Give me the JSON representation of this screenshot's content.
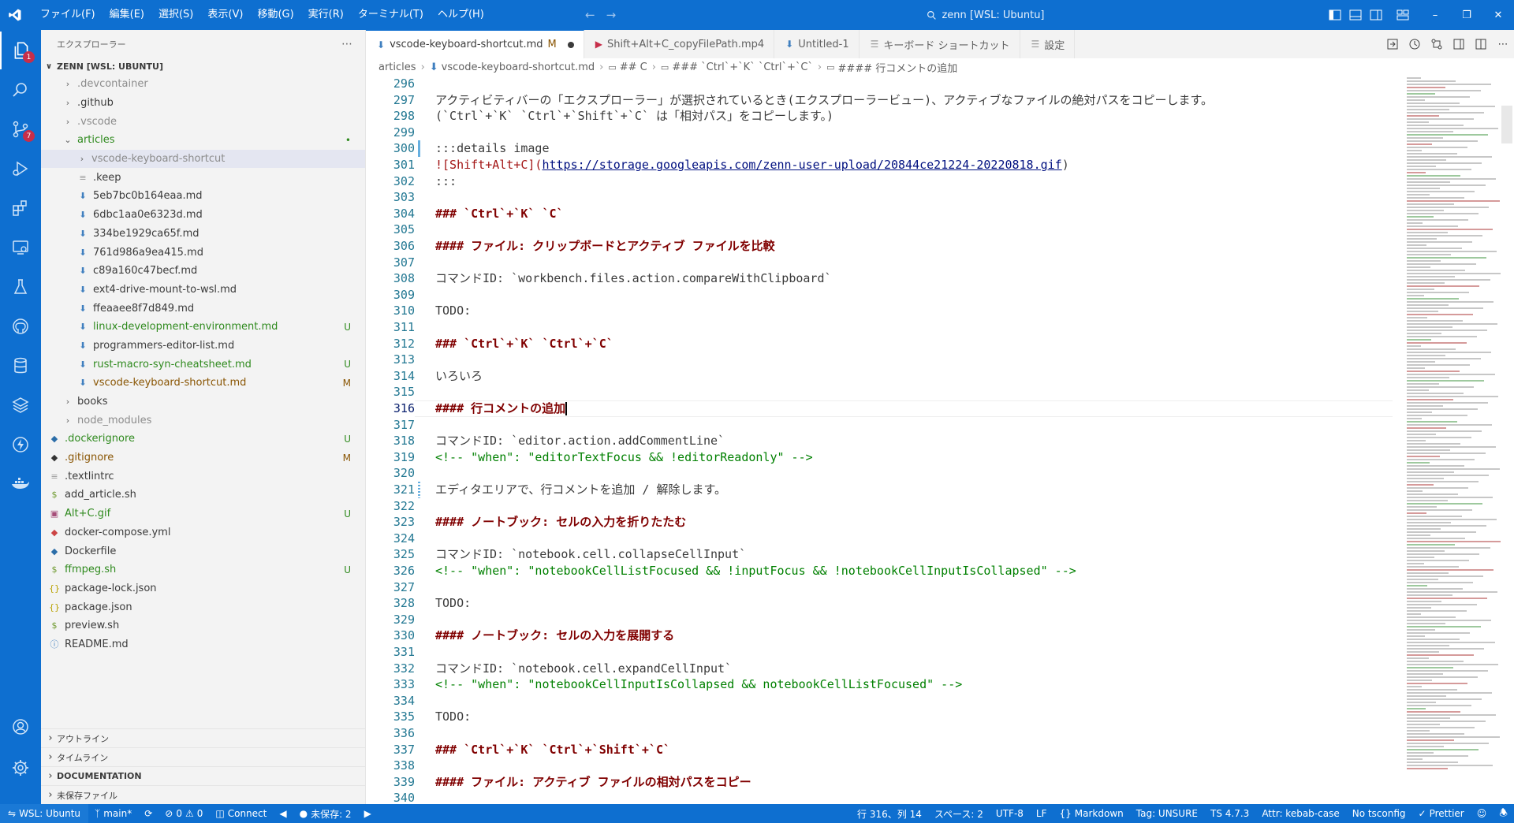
{
  "titlebar": {
    "menu": [
      "ファイル(F)",
      "編集(E)",
      "選択(S)",
      "表示(V)",
      "移動(G)",
      "実行(R)",
      "ターミナル(T)",
      "ヘルプ(H)"
    ],
    "command_center": "zenn [WSL: Ubuntu]"
  },
  "activitybar": {
    "explorer_badge": "1",
    "scm_badge": "7"
  },
  "sidebar": {
    "title": "エクスプローラー",
    "root": "ZENN [WSL: UBUNTU]",
    "tree": [
      {
        "name": ".devcontainer",
        "type": "folder",
        "depth": 1,
        "style": "dim",
        "status": ""
      },
      {
        "name": ".github",
        "type": "folder",
        "depth": 1,
        "style": "",
        "status": ""
      },
      {
        "name": ".vscode",
        "type": "folder",
        "depth": 1,
        "style": "dim",
        "status": ""
      },
      {
        "name": "articles",
        "type": "folder-open",
        "depth": 1,
        "style": "new",
        "status": "•"
      },
      {
        "name": "vscode-keyboard-shortcut",
        "type": "folder",
        "depth": 2,
        "style": "dim",
        "status": ""
      },
      {
        "name": ".keep",
        "type": "file",
        "depth": 2,
        "style": "",
        "status": ""
      },
      {
        "name": "5eb7bc0b164eaa.md",
        "type": "md",
        "depth": 2,
        "style": "",
        "status": ""
      },
      {
        "name": "6dbc1aa0e6323d.md",
        "type": "md",
        "depth": 2,
        "style": "",
        "status": ""
      },
      {
        "name": "334be1929ca65f.md",
        "type": "md",
        "depth": 2,
        "style": "",
        "status": ""
      },
      {
        "name": "761d986a9ea415.md",
        "type": "md",
        "depth": 2,
        "style": "",
        "status": ""
      },
      {
        "name": "c89a160c47becf.md",
        "type": "md",
        "depth": 2,
        "style": "",
        "status": ""
      },
      {
        "name": "ext4-drive-mount-to-wsl.md",
        "type": "md",
        "depth": 2,
        "style": "",
        "status": ""
      },
      {
        "name": "ffeaaee8f7d849.md",
        "type": "md",
        "depth": 2,
        "style": "",
        "status": ""
      },
      {
        "name": "linux-development-environment.md",
        "type": "md",
        "depth": 2,
        "style": "new",
        "status": "U"
      },
      {
        "name": "programmers-editor-list.md",
        "type": "md",
        "depth": 2,
        "style": "",
        "status": ""
      },
      {
        "name": "rust-macro-syn-cheatsheet.md",
        "type": "md",
        "depth": 2,
        "style": "new",
        "status": "U"
      },
      {
        "name": "vscode-keyboard-shortcut.md",
        "type": "md",
        "depth": 2,
        "style": "mod",
        "status": "M"
      },
      {
        "name": "books",
        "type": "folder",
        "depth": 1,
        "style": "",
        "status": ""
      },
      {
        "name": "node_modules",
        "type": "folder",
        "depth": 1,
        "style": "dim",
        "status": ""
      },
      {
        "name": ".dockerignore",
        "type": "docker",
        "depth": 0,
        "style": "new",
        "status": "U"
      },
      {
        "name": ".gitignore",
        "type": "git",
        "depth": 0,
        "style": "mod",
        "status": "M"
      },
      {
        "name": ".textlintrc",
        "type": "file",
        "depth": 0,
        "style": "",
        "status": ""
      },
      {
        "name": "add_article.sh",
        "type": "sh",
        "depth": 0,
        "style": "",
        "status": ""
      },
      {
        "name": "Alt+C.gif",
        "type": "img",
        "depth": 0,
        "style": "new",
        "status": "U"
      },
      {
        "name": "docker-compose.yml",
        "type": "yml",
        "depth": 0,
        "style": "",
        "status": ""
      },
      {
        "name": "Dockerfile",
        "type": "docker",
        "depth": 0,
        "style": "",
        "status": ""
      },
      {
        "name": "ffmpeg.sh",
        "type": "sh",
        "depth": 0,
        "style": "new",
        "status": "U"
      },
      {
        "name": "package-lock.json",
        "type": "json",
        "depth": 0,
        "style": "",
        "status": ""
      },
      {
        "name": "package.json",
        "type": "json",
        "depth": 0,
        "style": "",
        "status": ""
      },
      {
        "name": "preview.sh",
        "type": "sh",
        "depth": 0,
        "style": "",
        "status": ""
      },
      {
        "name": "README.md",
        "type": "info",
        "depth": 0,
        "style": "",
        "status": ""
      }
    ],
    "sections": [
      {
        "label": "アウトライン",
        "bold": false
      },
      {
        "label": "タイムライン",
        "bold": false
      },
      {
        "label": "DOCUMENTATION",
        "bold": true
      },
      {
        "label": "未保存ファイル",
        "bold": false
      }
    ]
  },
  "tabs": [
    {
      "label": "vscode-keyboard-shortcut.md",
      "suffix": "M",
      "active": true,
      "icon": "md",
      "dirty": true
    },
    {
      "label": "Shift+Alt+C_copyFilePath.mp4",
      "suffix": "",
      "active": false,
      "icon": "media",
      "dirty": false
    },
    {
      "label": "Untitled-1",
      "suffix": "",
      "active": false,
      "icon": "md",
      "dirty": false
    },
    {
      "label": "キーボード ショートカット",
      "suffix": "",
      "active": false,
      "icon": "list",
      "dirty": false
    },
    {
      "label": "設定",
      "suffix": "",
      "active": false,
      "icon": "list",
      "dirty": false
    }
  ],
  "breadcrumbs": [
    "articles",
    "vscode-keyboard-shortcut.md",
    "## C",
    "### `Ctrl`+`K` `Ctrl`+`C`",
    "#### 行コメントの追加"
  ],
  "editor": {
    "cursor_line": 316,
    "lines": [
      {
        "n": "296",
        "t": "",
        "k": ""
      },
      {
        "n": "297",
        "t": "アクティビティバーの「エクスプローラー」が選択されているとき(エクスプローラービュー)、アクティブなファイルの絶対パスをコピーします。",
        "k": ""
      },
      {
        "n": "298",
        "t": "(`Ctrl`+`K` `Ctrl`+`Shift`+`C` は「相対パス」をコピーします。)",
        "k": ""
      },
      {
        "n": "299",
        "t": "",
        "k": ""
      },
      {
        "n": "300",
        "t": ":::details image",
        "k": ""
      },
      {
        "n": "301",
        "t": "![Shift+Alt+C](https://storage.googleapis.com/zenn-user-upload/20844ce21224-20220818.gif)",
        "k": "link"
      },
      {
        "n": "302",
        "t": ":::",
        "k": ""
      },
      {
        "n": "303",
        "t": "",
        "k": ""
      },
      {
        "n": "304",
        "t": "### `Ctrl`+`K` `C`",
        "k": "hd"
      },
      {
        "n": "305",
        "t": "",
        "k": ""
      },
      {
        "n": "306",
        "t": "#### ファイル: クリップボードとアクティブ ファイルを比較",
        "k": "hd"
      },
      {
        "n": "307",
        "t": "",
        "k": ""
      },
      {
        "n": "308",
        "t": "コマンドID: `workbench.files.action.compareWithClipboard`",
        "k": ""
      },
      {
        "n": "309",
        "t": "",
        "k": ""
      },
      {
        "n": "310",
        "t": "TODO:",
        "k": ""
      },
      {
        "n": "311",
        "t": "",
        "k": ""
      },
      {
        "n": "312",
        "t": "### `Ctrl`+`K` `Ctrl`+`C`",
        "k": "hd"
      },
      {
        "n": "313",
        "t": "",
        "k": ""
      },
      {
        "n": "314",
        "t": "いろいろ",
        "k": ""
      },
      {
        "n": "315",
        "t": "",
        "k": ""
      },
      {
        "n": "316",
        "t": "#### 行コメントの追加",
        "k": "hd"
      },
      {
        "n": "317",
        "t": "",
        "k": ""
      },
      {
        "n": "318",
        "t": "コマンドID: `editor.action.addCommentLine`",
        "k": ""
      },
      {
        "n": "319",
        "t": "<!-- \"when\": \"editorTextFocus && !editorReadonly\" -->",
        "k": "cm"
      },
      {
        "n": "320",
        "t": "",
        "k": ""
      },
      {
        "n": "321",
        "t": "エディタエリアで、行コメントを追加 / 解除します。",
        "k": ""
      },
      {
        "n": "322",
        "t": "",
        "k": ""
      },
      {
        "n": "323",
        "t": "#### ノートブック: セルの入力を折りたたむ",
        "k": "hd"
      },
      {
        "n": "324",
        "t": "",
        "k": ""
      },
      {
        "n": "325",
        "t": "コマンドID: `notebook.cell.collapseCellInput`",
        "k": ""
      },
      {
        "n": "326",
        "t": "<!-- \"when\": \"notebookCellListFocused && !inputFocus && !notebookCellInputIsCollapsed\" -->",
        "k": "cm"
      },
      {
        "n": "327",
        "t": "",
        "k": ""
      },
      {
        "n": "328",
        "t": "TODO:",
        "k": ""
      },
      {
        "n": "329",
        "t": "",
        "k": ""
      },
      {
        "n": "330",
        "t": "#### ノートブック: セルの入力を展開する",
        "k": "hd"
      },
      {
        "n": "331",
        "t": "",
        "k": ""
      },
      {
        "n": "332",
        "t": "コマンドID: `notebook.cell.expandCellInput`",
        "k": ""
      },
      {
        "n": "333",
        "t": "<!-- \"when\": \"notebookCellInputIsCollapsed && notebookCellListFocused\" -->",
        "k": "cm"
      },
      {
        "n": "334",
        "t": "",
        "k": ""
      },
      {
        "n": "335",
        "t": "TODO:",
        "k": ""
      },
      {
        "n": "336",
        "t": "",
        "k": ""
      },
      {
        "n": "337",
        "t": "### `Ctrl`+`K` `Ctrl`+`Shift`+`C`",
        "k": "hd"
      },
      {
        "n": "338",
        "t": "",
        "k": ""
      },
      {
        "n": "339",
        "t": "#### ファイル: アクティブ ファイルの相対パスをコピー",
        "k": "hd"
      },
      {
        "n": "340",
        "t": "",
        "k": ""
      }
    ]
  },
  "statusbar": {
    "remote": "WSL: Ubuntu",
    "branch": "main*",
    "errors": "0",
    "warnings": "0",
    "connect": "Connect",
    "unsaved": "未保存: 2",
    "position": "行 316、列 14",
    "spaces": "スペース: 2",
    "encoding": "UTF-8",
    "eol": "LF",
    "language": "Markdown",
    "tag": "Tag: UNSURE",
    "ts": "TS 4.7.3",
    "attr": "Attr: kebab-case",
    "tsconfig": "No tsconfig",
    "prettier": "Prettier"
  },
  "colors": {
    "accent": "#0e6fd0",
    "heading": "#800000",
    "comment": "#008000",
    "modified": "#895503",
    "untracked": "#2f8a1e"
  }
}
